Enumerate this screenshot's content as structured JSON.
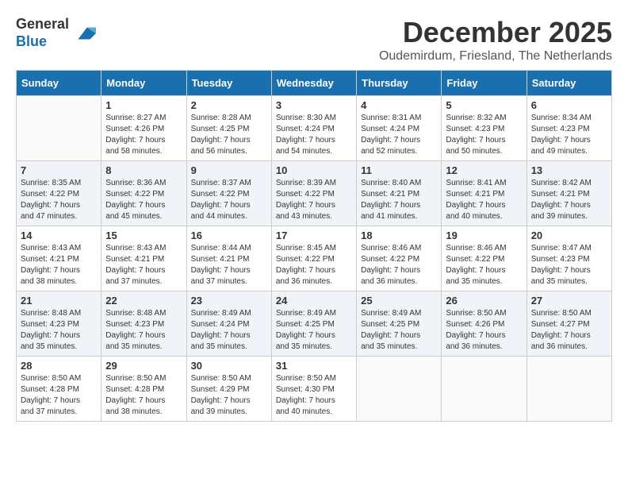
{
  "logo": {
    "general": "General",
    "blue": "Blue"
  },
  "title": "December 2025",
  "location": "Oudemirdum, Friesland, The Netherlands",
  "days_of_week": [
    "Sunday",
    "Monday",
    "Tuesday",
    "Wednesday",
    "Thursday",
    "Friday",
    "Saturday"
  ],
  "weeks": [
    [
      {
        "day": "",
        "info": ""
      },
      {
        "day": "1",
        "info": "Sunrise: 8:27 AM\nSunset: 4:26 PM\nDaylight: 7 hours\nand 58 minutes."
      },
      {
        "day": "2",
        "info": "Sunrise: 8:28 AM\nSunset: 4:25 PM\nDaylight: 7 hours\nand 56 minutes."
      },
      {
        "day": "3",
        "info": "Sunrise: 8:30 AM\nSunset: 4:24 PM\nDaylight: 7 hours\nand 54 minutes."
      },
      {
        "day": "4",
        "info": "Sunrise: 8:31 AM\nSunset: 4:24 PM\nDaylight: 7 hours\nand 52 minutes."
      },
      {
        "day": "5",
        "info": "Sunrise: 8:32 AM\nSunset: 4:23 PM\nDaylight: 7 hours\nand 50 minutes."
      },
      {
        "day": "6",
        "info": "Sunrise: 8:34 AM\nSunset: 4:23 PM\nDaylight: 7 hours\nand 49 minutes."
      }
    ],
    [
      {
        "day": "7",
        "info": "Sunrise: 8:35 AM\nSunset: 4:22 PM\nDaylight: 7 hours\nand 47 minutes."
      },
      {
        "day": "8",
        "info": "Sunrise: 8:36 AM\nSunset: 4:22 PM\nDaylight: 7 hours\nand 45 minutes."
      },
      {
        "day": "9",
        "info": "Sunrise: 8:37 AM\nSunset: 4:22 PM\nDaylight: 7 hours\nand 44 minutes."
      },
      {
        "day": "10",
        "info": "Sunrise: 8:39 AM\nSunset: 4:22 PM\nDaylight: 7 hours\nand 43 minutes."
      },
      {
        "day": "11",
        "info": "Sunrise: 8:40 AM\nSunset: 4:21 PM\nDaylight: 7 hours\nand 41 minutes."
      },
      {
        "day": "12",
        "info": "Sunrise: 8:41 AM\nSunset: 4:21 PM\nDaylight: 7 hours\nand 40 minutes."
      },
      {
        "day": "13",
        "info": "Sunrise: 8:42 AM\nSunset: 4:21 PM\nDaylight: 7 hours\nand 39 minutes."
      }
    ],
    [
      {
        "day": "14",
        "info": "Sunrise: 8:43 AM\nSunset: 4:21 PM\nDaylight: 7 hours\nand 38 minutes."
      },
      {
        "day": "15",
        "info": "Sunrise: 8:43 AM\nSunset: 4:21 PM\nDaylight: 7 hours\nand 37 minutes."
      },
      {
        "day": "16",
        "info": "Sunrise: 8:44 AM\nSunset: 4:21 PM\nDaylight: 7 hours\nand 37 minutes."
      },
      {
        "day": "17",
        "info": "Sunrise: 8:45 AM\nSunset: 4:22 PM\nDaylight: 7 hours\nand 36 minutes."
      },
      {
        "day": "18",
        "info": "Sunrise: 8:46 AM\nSunset: 4:22 PM\nDaylight: 7 hours\nand 36 minutes."
      },
      {
        "day": "19",
        "info": "Sunrise: 8:46 AM\nSunset: 4:22 PM\nDaylight: 7 hours\nand 35 minutes."
      },
      {
        "day": "20",
        "info": "Sunrise: 8:47 AM\nSunset: 4:23 PM\nDaylight: 7 hours\nand 35 minutes."
      }
    ],
    [
      {
        "day": "21",
        "info": "Sunrise: 8:48 AM\nSunset: 4:23 PM\nDaylight: 7 hours\nand 35 minutes."
      },
      {
        "day": "22",
        "info": "Sunrise: 8:48 AM\nSunset: 4:23 PM\nDaylight: 7 hours\nand 35 minutes."
      },
      {
        "day": "23",
        "info": "Sunrise: 8:49 AM\nSunset: 4:24 PM\nDaylight: 7 hours\nand 35 minutes."
      },
      {
        "day": "24",
        "info": "Sunrise: 8:49 AM\nSunset: 4:25 PM\nDaylight: 7 hours\nand 35 minutes."
      },
      {
        "day": "25",
        "info": "Sunrise: 8:49 AM\nSunset: 4:25 PM\nDaylight: 7 hours\nand 35 minutes."
      },
      {
        "day": "26",
        "info": "Sunrise: 8:50 AM\nSunset: 4:26 PM\nDaylight: 7 hours\nand 36 minutes."
      },
      {
        "day": "27",
        "info": "Sunrise: 8:50 AM\nSunset: 4:27 PM\nDaylight: 7 hours\nand 36 minutes."
      }
    ],
    [
      {
        "day": "28",
        "info": "Sunrise: 8:50 AM\nSunset: 4:28 PM\nDaylight: 7 hours\nand 37 minutes."
      },
      {
        "day": "29",
        "info": "Sunrise: 8:50 AM\nSunset: 4:28 PM\nDaylight: 7 hours\nand 38 minutes."
      },
      {
        "day": "30",
        "info": "Sunrise: 8:50 AM\nSunset: 4:29 PM\nDaylight: 7 hours\nand 39 minutes."
      },
      {
        "day": "31",
        "info": "Sunrise: 8:50 AM\nSunset: 4:30 PM\nDaylight: 7 hours\nand 40 minutes."
      },
      {
        "day": "",
        "info": ""
      },
      {
        "day": "",
        "info": ""
      },
      {
        "day": "",
        "info": ""
      }
    ]
  ]
}
